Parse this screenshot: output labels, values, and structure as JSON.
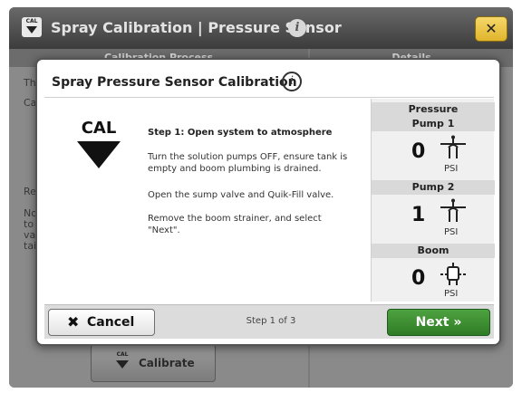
{
  "background": {
    "cal_icon_text": "CAL",
    "title": "Spray Calibration | Pressure Sensor",
    "close_icon": "close-icon",
    "columns": {
      "left": "Calibration Process",
      "right": "Details"
    },
    "fragments": [
      "Th",
      "Ca",
      "Re",
      "No",
      "to",
      "va",
      "tai"
    ],
    "calibrate_button": {
      "icon_text": "CAL",
      "label": "Calibrate"
    }
  },
  "dialog": {
    "title": "Spray Pressure Sensor Calibration",
    "info_icon_glyph": "i",
    "cal_label": "CAL",
    "step_heading": "Step 1: Open system to atmosphere",
    "instructions": [
      "Turn the solution pumps OFF, ensure tank is empty and boom plumbing is drained.",
      "Open the sump valve and Quik-Fill valve.",
      "Remove the boom strainer, and select \"Next\"."
    ],
    "pressure": {
      "header": "Pressure",
      "sensors": [
        {
          "label": "Pump 1",
          "value": "0",
          "unit": "PSI",
          "icon": "pump-sensor-icon"
        },
        {
          "label": "Pump 2",
          "value": "1",
          "unit": "PSI",
          "icon": "pump-sensor-icon"
        },
        {
          "label": "Boom",
          "value": "0",
          "unit": "PSI",
          "icon": "boom-sensor-icon"
        }
      ]
    },
    "footer": {
      "cancel_label": "Cancel",
      "step_counter": "Step 1 of 3",
      "next_label": "Next »"
    }
  },
  "colors": {
    "next_green": "#3a8d30",
    "close_yellow": "#e8c43e",
    "title_bar": "#4a4a4a"
  }
}
